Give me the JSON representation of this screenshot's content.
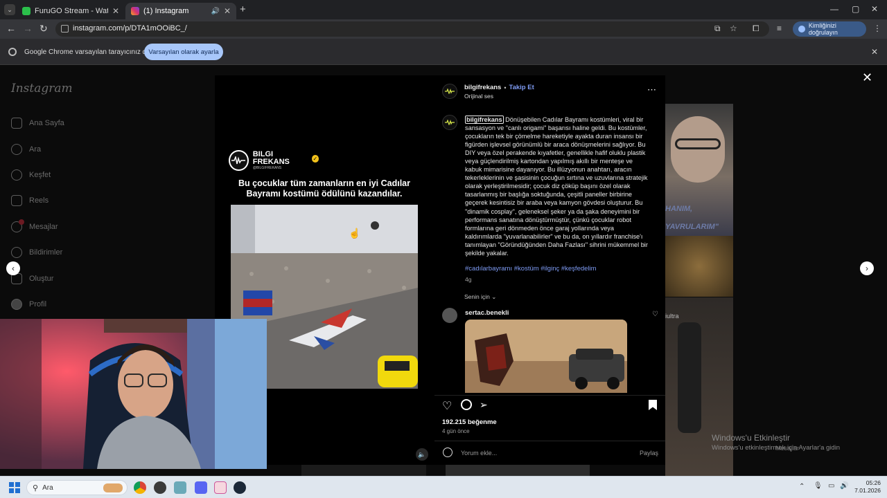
{
  "browser": {
    "tabs": [
      {
        "title": "FuruGO Stream - Watch Live o",
        "fav_color": "#2bbf4b"
      },
      {
        "title": "(1) Instagram",
        "fav_color": "#d6336c"
      }
    ],
    "url": "instagram.com/p/DTA1mOOiBC_/",
    "profile_label": "Kimliğinizi doğrulayın"
  },
  "infobar": {
    "message": "Google Chrome varsayılan tarayıcınız değil",
    "button": "Varsayılan olarak ayarla"
  },
  "instagram": {
    "logo": "Instagram",
    "nav": [
      {
        "label": "Ana Sayfa",
        "icon": "home-icon"
      },
      {
        "label": "Ara",
        "icon": "search-icon"
      },
      {
        "label": "Keşfet",
        "icon": "compass-icon"
      },
      {
        "label": "Reels",
        "icon": "reels-icon"
      },
      {
        "label": "Mesajlar",
        "icon": "messenger-icon"
      },
      {
        "label": "Bildirimler",
        "icon": "heart-icon"
      },
      {
        "label": "Oluştur",
        "icon": "plus-icon"
      },
      {
        "label": "Profil",
        "icon": "profile-icon"
      }
    ],
    "messages_badge": "1",
    "bg_tile_text": {
      "t1": "HANIM,",
      "t2": "YAVRULARIM\"",
      "t3": "iultra"
    }
  },
  "media": {
    "brand_name": "BILGI FREKANS",
    "brand_handle": "@BILGIFREKANS",
    "headline": "Bu çocuklar tüm zamanların en iyi Cadılar Bayramı kostümü ödülünü kazandılar."
  },
  "post": {
    "username": "bilgifrekans",
    "follow": "Takip Et",
    "audio": "Orijinal ses",
    "caption_user": "bilgifrekans",
    "caption": "Dönüşebilen Cadılar Bayramı kostümleri, viral bir sansasyon ve \"canlı origami\" başarısı haline geldi. Bu kostümler, çocukların tek bir çömelme hareketiyle ayakta duran insansı bir figürden işlevsel görünümlü bir araca dönüşmelerini sağlıyor. Bu DIY veya özel perakende kıyafetler, genellikle hafif oluklu plastik veya güçlendirilmiş kartondan yapılmış akıllı bir menteşe ve kabuk mimarisine dayanıyor. Bu illüzyonun anahtarı, aracın tekerleklerinin ve şasisinin çocuğun sırtına ve uzuvlarına stratejik olarak yerleştirilmesidir; çocuk diz çöküp başını özel olarak tasarlanmış bir başlığa soktuğunda, çeşitli paneller birbirine geçerek kesintisiz bir araba veya kamyon gövdesi oluşturur. Bu \"dinamik cosplay\", geleneksel şeker ya da şaka deneyimini bir performans sanatına dönüştürmüştür, çünkü çocuklar robot formlarına geri dönmeden önce garaj yollarında veya kaldırımlarda \"yuvarlanabilirler\" ve bu da, on yıllardır franchise'ı tanımlayan \"Göründüğünden Daha Fazlası\" sihrini mükemmel bir şekilde yakalar.",
    "hashtags": "#cadılarbayramı #kostüm #ilginç #keşfedelim",
    "caption_age": "4g",
    "for_you": "Senin için",
    "commenter": "sertac.benekli",
    "likes": "192.215 beğenme",
    "posted": "4 gün önce",
    "comment_placeholder": "Yorum ekle...",
    "share": "Paylaş"
  },
  "overlay": {
    "activate_title": "Windows'u Etkinleştir",
    "activate_sub": "Windows'u etkinleştirmek için Ayarlar'a gidin",
    "messages_float": "Mesajlar"
  },
  "taskbar": {
    "search": "Ara",
    "time": "05:26",
    "date": "7.01.2026"
  },
  "colors": {
    "accent": "#0095f6",
    "link": "#7f9cf5",
    "brand_yellow": "#d7e84a"
  }
}
